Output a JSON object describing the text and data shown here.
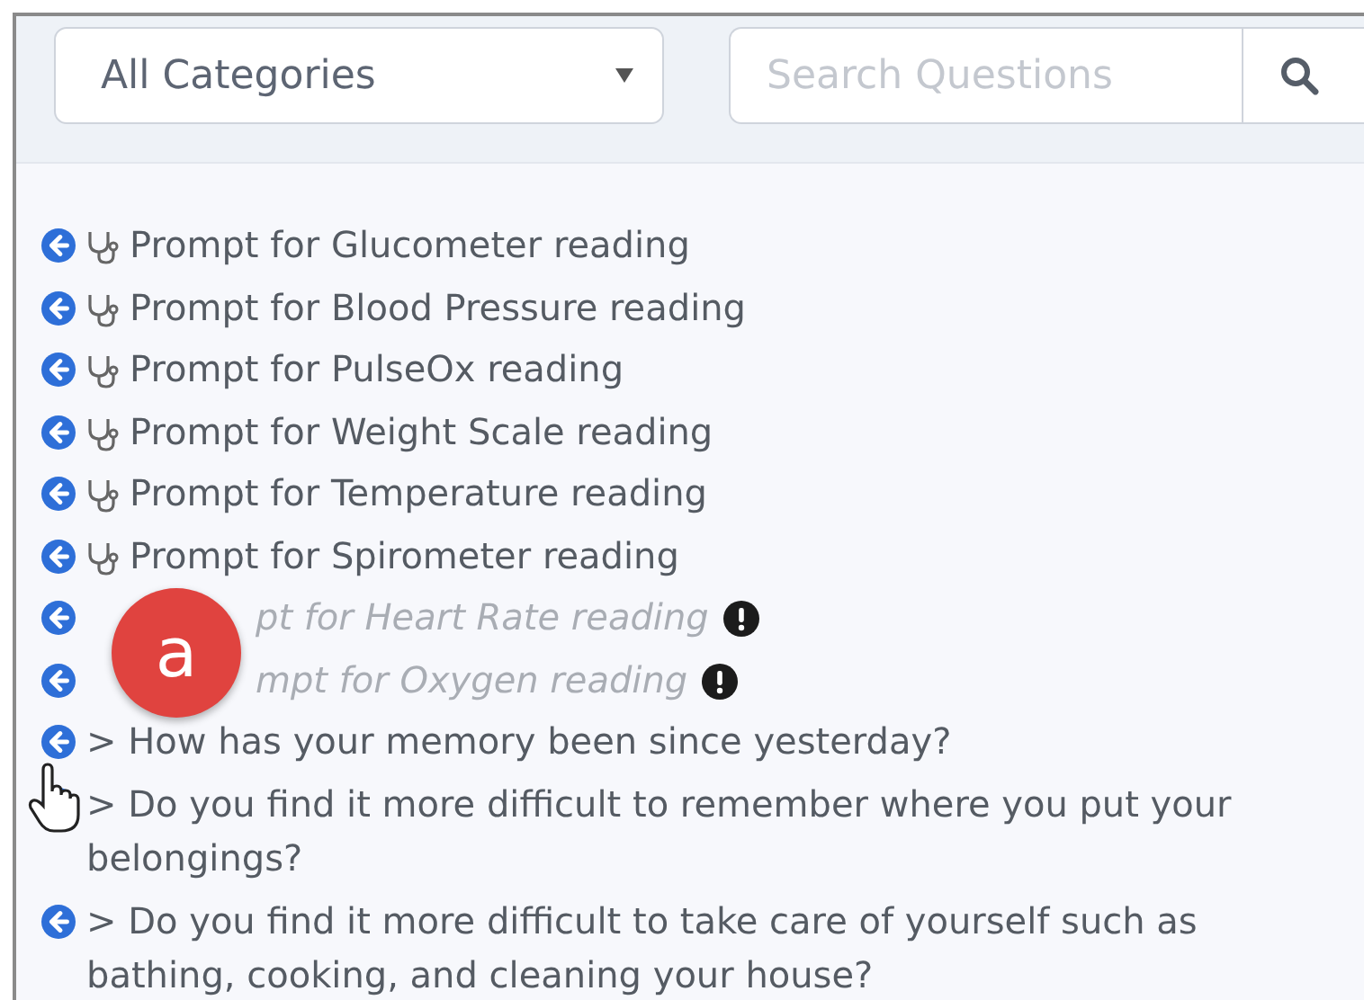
{
  "filter": {
    "category": "All Categories",
    "search_placeholder": "Search Questions"
  },
  "items": [
    {
      "kind": "device",
      "text": "Prompt for Glucometer reading"
    },
    {
      "kind": "device",
      "text": "Prompt for Blood Pressure reading"
    },
    {
      "kind": "device",
      "text": "Prompt for PulseOx reading"
    },
    {
      "kind": "device",
      "text": "Prompt for Weight Scale reading"
    },
    {
      "kind": "device",
      "text": "Prompt for Temperature reading"
    },
    {
      "kind": "device",
      "text": "Prompt for Spirometer reading"
    },
    {
      "kind": "covered",
      "text": "pt for Heart Rate reading",
      "disabled": true
    },
    {
      "kind": "covered",
      "text": "mpt for Oxygen reading",
      "disabled": true
    },
    {
      "kind": "question",
      "text": "> How has your memory been since yesterday?"
    },
    {
      "kind": "question",
      "text": "> Do you find it more difficult to remember where you put your belongings?",
      "hovered": true
    },
    {
      "kind": "question",
      "text": "> Do you find it more difficult to take care of yourself such as bathing, cooking, and cleaning your house?"
    }
  ],
  "badge": "a"
}
